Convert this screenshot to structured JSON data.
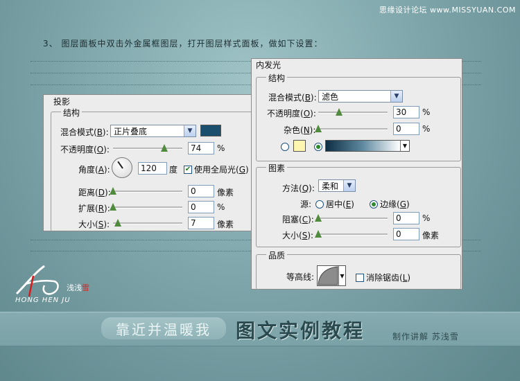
{
  "watermark": "思缘设计论坛 www.MISSYUAN.COM",
  "instruction": "3、 图层面板中双击外金属框图层，打开图层样式面板，做如下设置：",
  "drop_shadow": {
    "title": "投影",
    "group": "结构",
    "blend_mode_label_pre": "混合模式(",
    "blend_mode_key": "B",
    "blend_mode_label_post": "):",
    "blend_mode_value": "正片叠底",
    "color": "#1b4f6e",
    "opacity_label_pre": "不透明度(",
    "opacity_key": "O",
    "opacity_label_post": "):",
    "opacity_value": "74",
    "opacity_pct": 74,
    "angle_label_pre": "角度(",
    "angle_key": "A",
    "angle_label_post": "):",
    "angle_value": "120",
    "angle_unit": "度",
    "global_light_label_pre": "使用全局光(",
    "global_light_key": "G",
    "global_light_label_post": ")",
    "distance_label_pre": "距离(",
    "distance_key": "D",
    "distance_label_post": "):",
    "distance_value": "0",
    "distance_unit": "像素",
    "spread_label_pre": "扩展(",
    "spread_key": "R",
    "spread_label_post": "):",
    "spread_value": "0",
    "spread_unit": "%",
    "size_label_pre": "大小(",
    "size_key": "S",
    "size_label_post": "):",
    "size_value": "7",
    "size_unit": "像素",
    "pct_unit": "%"
  },
  "inner_glow": {
    "title": "内发光",
    "structure_group": "结构",
    "blend_mode_label_pre": "混合模式(",
    "blend_mode_key": "B",
    "blend_mode_label_post": "):",
    "blend_mode_value": "滤色",
    "opacity_label_pre": "不透明度(",
    "opacity_key": "O",
    "opacity_label_post": "):",
    "opacity_value": "30",
    "opacity_pct": 30,
    "opacity_unit": "%",
    "noise_label_pre": "杂色(",
    "noise_key": "N",
    "noise_label_post": "):",
    "noise_value": "0",
    "noise_unit": "%",
    "glow_color": "#fdf6b0",
    "elements_group": "图素",
    "method_label_pre": "方法(",
    "method_key": "Q",
    "method_label_post": "):",
    "method_value": "柔和",
    "source_label": "源:",
    "center_label_pre": "居中(",
    "center_key": "E",
    "center_label_post": ")",
    "edge_label_pre": "边缘(",
    "edge_key": "G",
    "edge_label_post": ")",
    "choke_label_pre": "阻塞(",
    "choke_key": "C",
    "choke_label_post": "):",
    "choke_value": "0",
    "choke_unit": "%",
    "size_label_pre": "大小(",
    "size_key": "S",
    "size_label_post": "):",
    "size_value": "0",
    "size_unit": "像素",
    "quality_group": "品质",
    "contour_label": "等高线:",
    "antialias_label_pre": "消除锯齿(",
    "antialias_key": "L",
    "antialias_label_post": ")"
  },
  "logo": {
    "name_prefix": "浅浅",
    "name_red": "雪",
    "sub": "HONG HEN JU"
  },
  "footer": {
    "slogan": "靠近并温暖我",
    "title": "图文实例教程",
    "author": "制作讲解  苏浅雪"
  }
}
